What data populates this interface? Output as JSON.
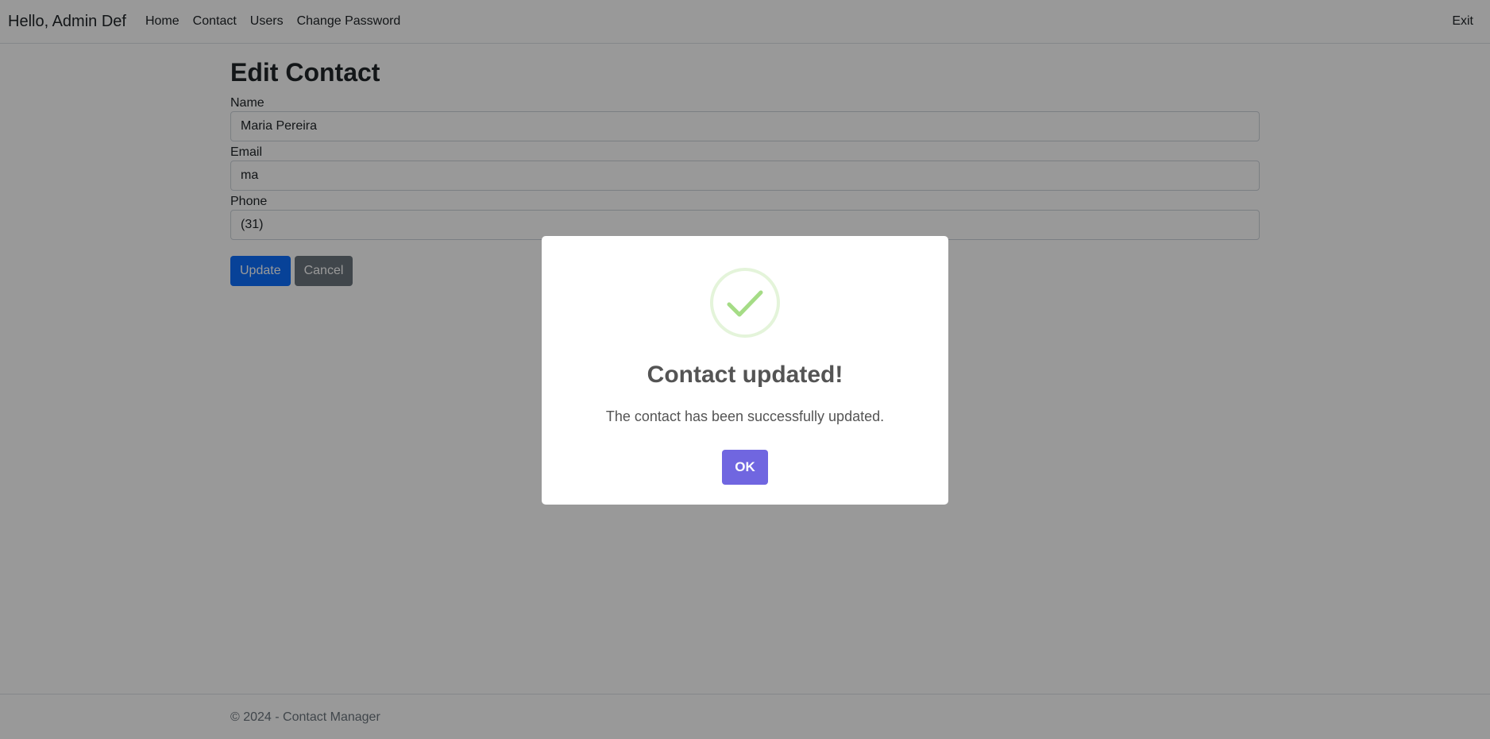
{
  "navbar": {
    "brand": "Hello, Admin Def",
    "links": [
      "Home",
      "Contact",
      "Users",
      "Change Password"
    ],
    "exit": "Exit"
  },
  "main": {
    "title": "Edit Contact",
    "fields": {
      "name_label": "Name",
      "name_value": "Maria Pereira",
      "email_label": "Email",
      "email_value": "ma",
      "phone_label": "Phone",
      "phone_value": "(31)"
    },
    "buttons": {
      "update": "Update",
      "cancel": "Cancel"
    }
  },
  "footer": {
    "text": "© 2024 - Contact Manager"
  },
  "modal": {
    "icon": "success-check-icon",
    "title": "Contact updated!",
    "message": "The contact has been successfully updated.",
    "ok": "OK",
    "colors": {
      "confirm_button": "#7066e0",
      "check": "#a5dc86"
    }
  }
}
